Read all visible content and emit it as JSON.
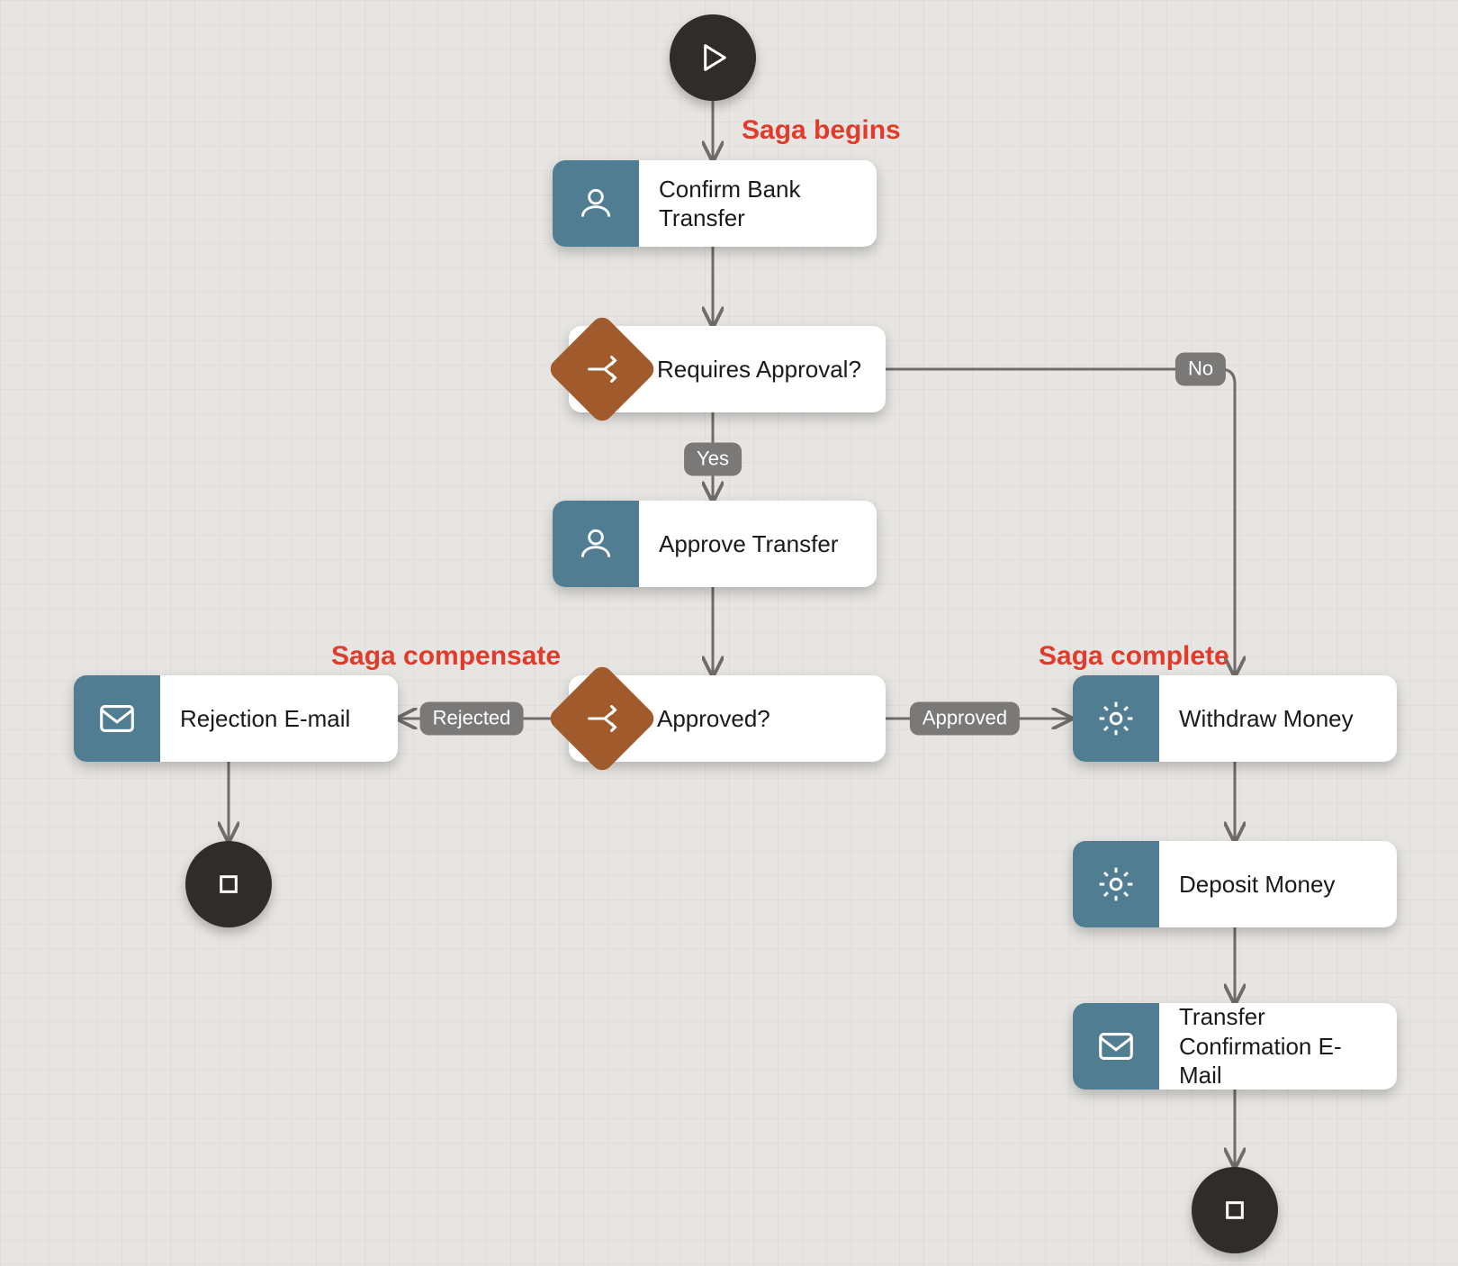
{
  "nodes": {
    "start": {
      "kind": "start",
      "label": ""
    },
    "confirm": {
      "kind": "user",
      "label": "Confirm Bank Transfer"
    },
    "requiresApproval": {
      "kind": "decision",
      "label": "Requires Approval?"
    },
    "approveTransfer": {
      "kind": "user",
      "label": "Approve Transfer"
    },
    "approved": {
      "kind": "decision",
      "label": "Approved?"
    },
    "rejectionMail": {
      "kind": "mail",
      "label": "Rejection E-mail"
    },
    "withdraw": {
      "kind": "service",
      "label": "Withdraw Money"
    },
    "deposit": {
      "kind": "service",
      "label": "Deposit Money"
    },
    "confirmMail": {
      "kind": "mail",
      "label": "Transfer Confirmation E-Mail"
    },
    "endReject": {
      "kind": "end",
      "label": ""
    },
    "endSuccess": {
      "kind": "end",
      "label": ""
    }
  },
  "edgeLabels": {
    "requiresYes": "Yes",
    "requiresNo": "No",
    "approvedYes": "Approved",
    "approvedNo": "Rejected"
  },
  "annotations": {
    "begins": "Saga begins",
    "compensate": "Saga compensate",
    "complete": "Saga complete"
  },
  "colors": {
    "taskIcon": "#517d92",
    "decisionIcon": "#a05a2c",
    "circle": "#2f2c2a",
    "annotation": "#e13b2b",
    "edge": "#6f6c69"
  }
}
